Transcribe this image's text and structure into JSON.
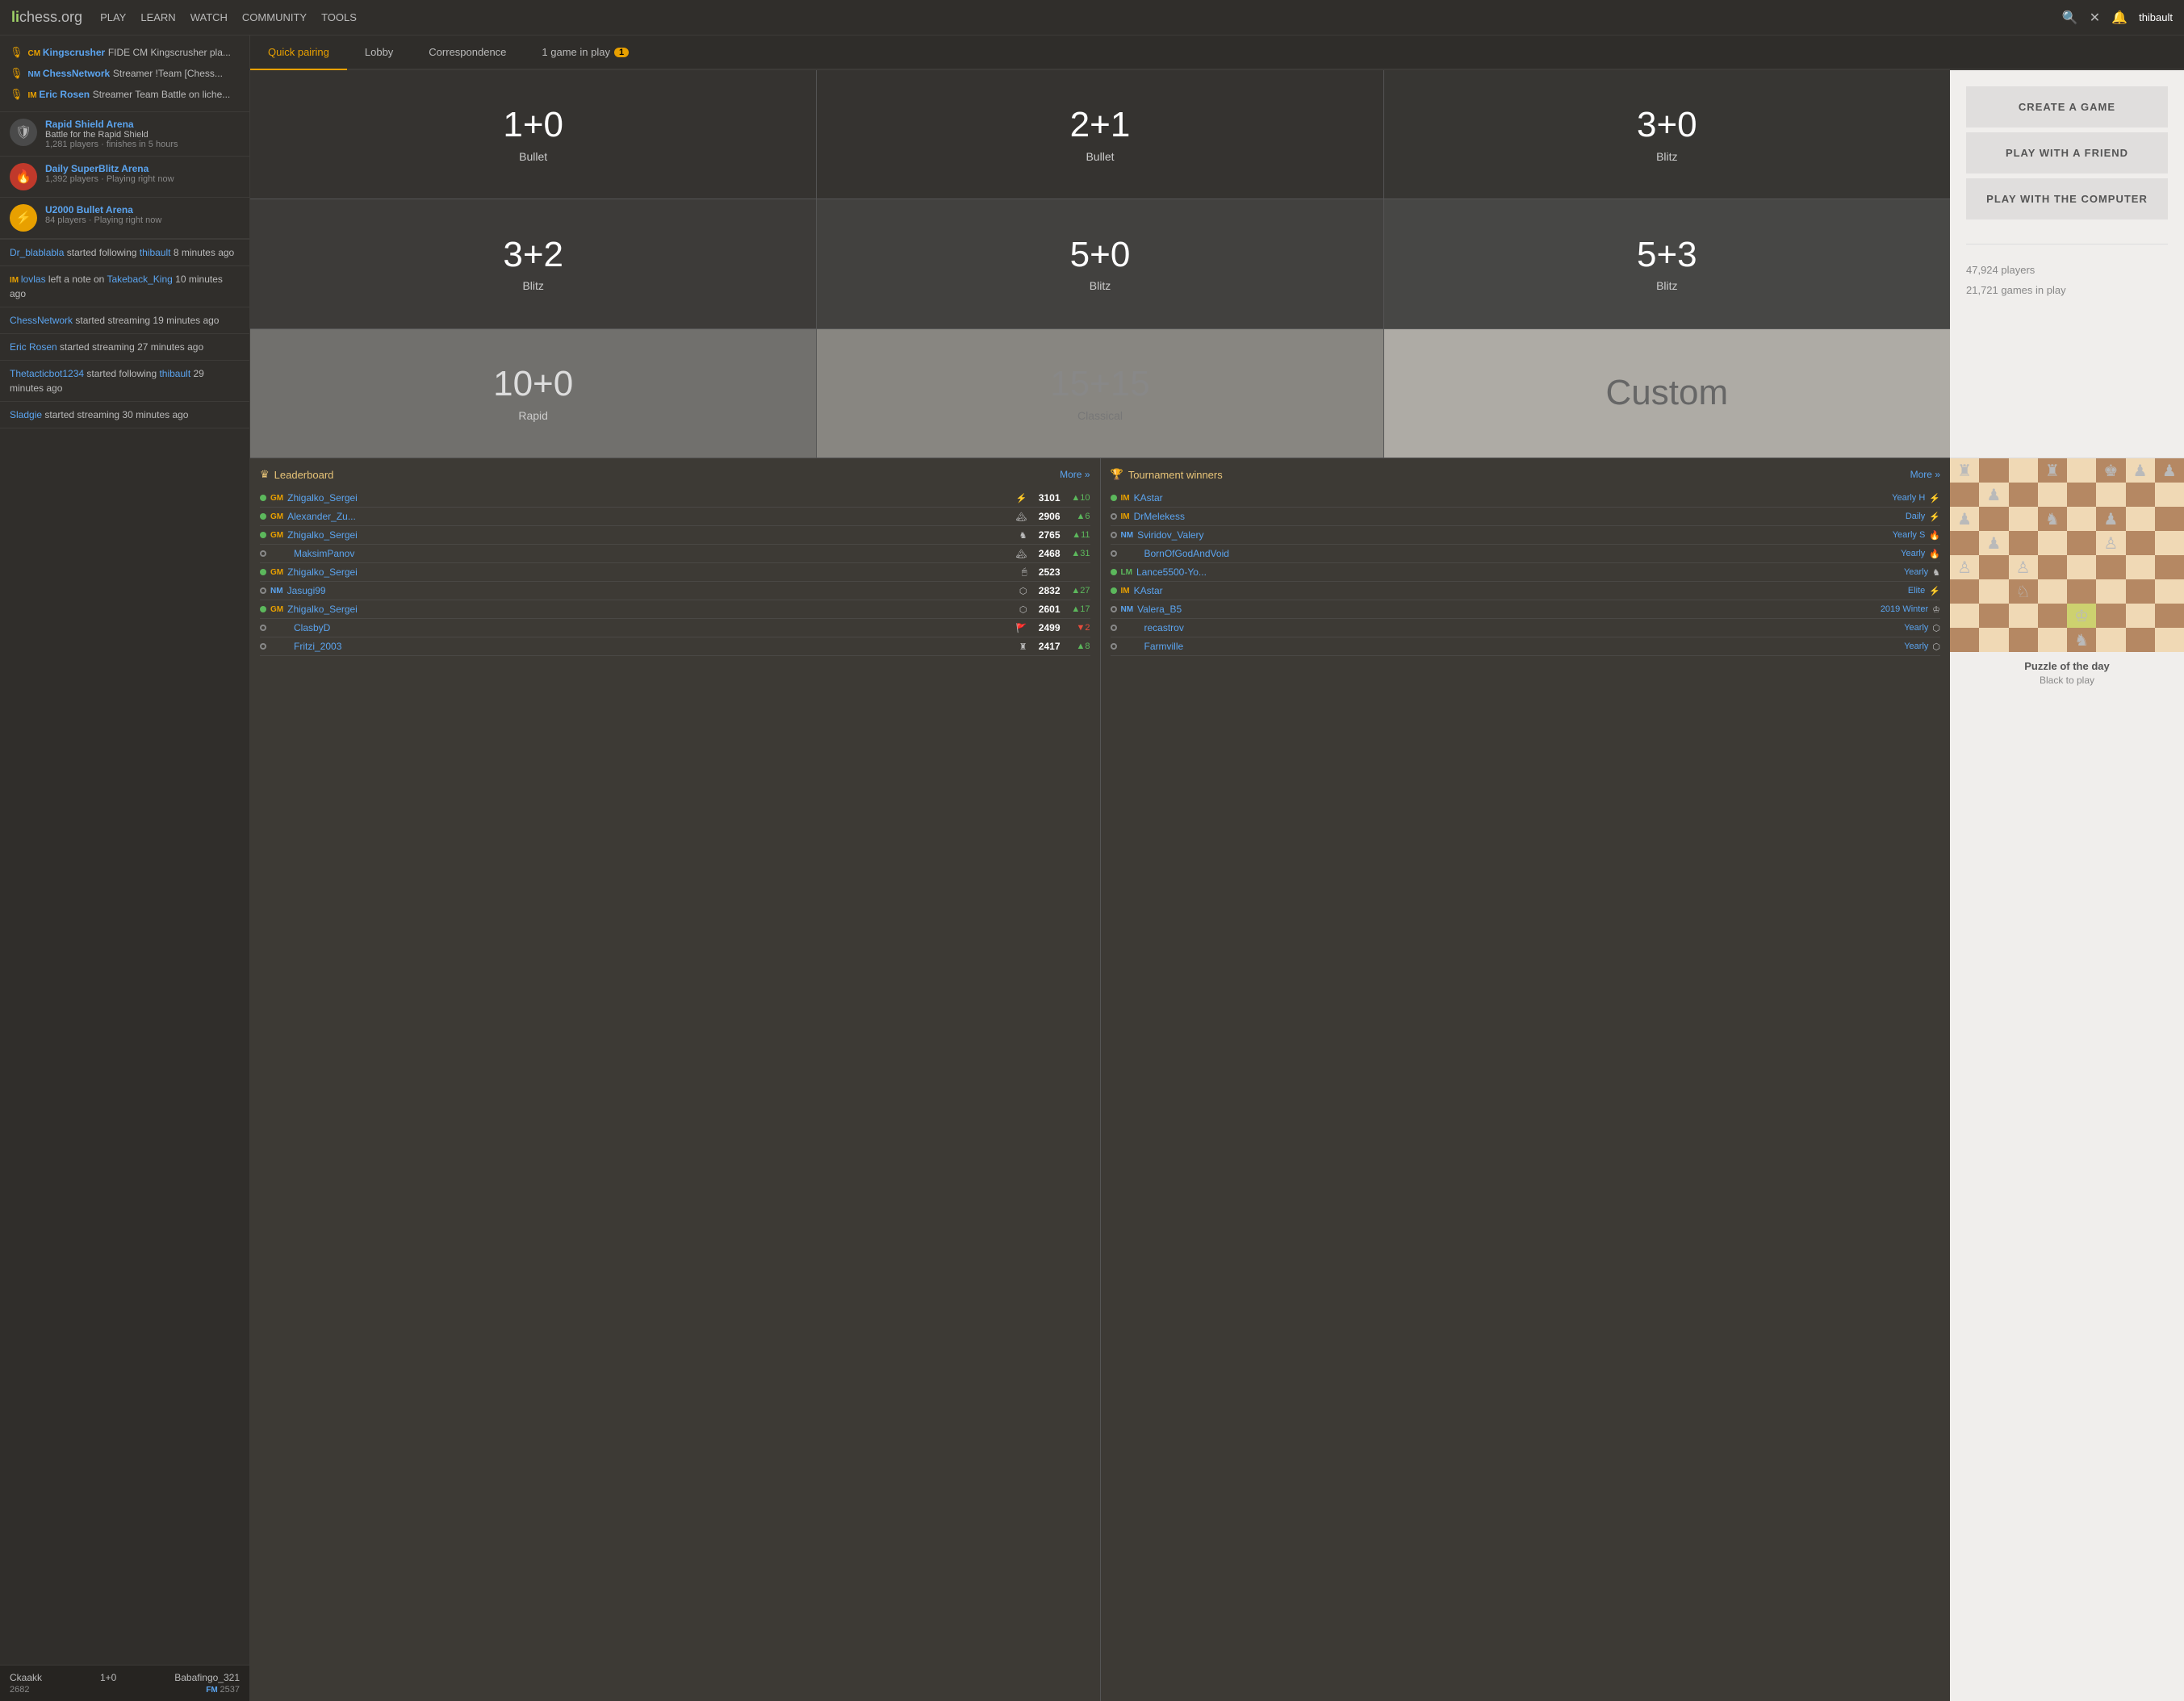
{
  "site": {
    "logo": "lichess",
    "logo_suffix": ".org"
  },
  "nav": {
    "links": [
      "PLAY",
      "LEARN",
      "WATCH",
      "COMMUNITY",
      "TOOLS"
    ],
    "username": "thibault",
    "game_in_play": "1 game in play",
    "game_badge": "1"
  },
  "tabs": [
    {
      "label": "Quick pairing",
      "active": true
    },
    {
      "label": "Lobby"
    },
    {
      "label": "Correspondence"
    },
    {
      "label": "1 game in play",
      "badge": "1"
    }
  ],
  "pairing_options": [
    {
      "time": "1+0",
      "type": "Bullet"
    },
    {
      "time": "2+1",
      "type": "Bullet"
    },
    {
      "time": "3+0",
      "type": "Blitz"
    },
    {
      "time": "3+2",
      "type": "Blitz"
    },
    {
      "time": "5+0",
      "type": "Blitz"
    },
    {
      "time": "5+3",
      "type": "Blitz"
    },
    {
      "time": "10+0",
      "type": "Rapid"
    },
    {
      "time": "15+15",
      "type": "Classical"
    },
    {
      "time": "Custom",
      "type": ""
    }
  ],
  "right_sidebar": {
    "create_game": "CREATE A GAME",
    "play_friend": "PLAY WITH A FRIEND",
    "play_computer": "PLAY WITH THE COMPUTER",
    "players_online": "47,924 players",
    "games_in_play": "21,721 games in play"
  },
  "streamers": [
    {
      "title": "CM",
      "name": "Kingscrusher",
      "desc": "FIDE CM Kingscrusher pla..."
    },
    {
      "title": "NM",
      "name": "ChessNetwork",
      "desc": "Streamer !Team [Chess..."
    },
    {
      "title": "IM",
      "name": "Eric Rosen",
      "desc": "Streamer Team Battle on liche..."
    }
  ],
  "tournaments": [
    {
      "type": "shield",
      "title": "Rapid Shield Arena",
      "subtitle": "Battle for the Rapid Shield",
      "meta": "1,281 players · finishes  in 5 hours"
    },
    {
      "type": "fire",
      "title": "Daily SuperBlitz Arena",
      "subtitle": "",
      "meta": "1,392 players · Playing right now"
    },
    {
      "type": "bolt",
      "title": "U2000 Bullet Arena",
      "subtitle": "",
      "meta": "84 players · Playing right now"
    }
  ],
  "activity": [
    {
      "text": "Dr_blablabla started following thibault 8 minutes ago",
      "links": [
        "Dr_blablabla",
        "thibault"
      ]
    },
    {
      "text": "IM lovlas left a note on Takeback_King 10 minutes ago",
      "links": [
        "lovlas",
        "Takeback_King"
      ]
    },
    {
      "text": "ChessNetwork started streaming 19 minutes ago",
      "links": [
        "ChessNetwork"
      ]
    },
    {
      "text": "Eric Rosen started streaming 27 minutes ago",
      "links": [
        "Eric Rosen"
      ]
    },
    {
      "text": "Thetacticbot1234 started following thibault 29 minutes ago",
      "links": [
        "Thetacticbot1234",
        "thibault"
      ]
    },
    {
      "text": "Sladgie started streaming 30 minutes ago",
      "links": [
        "Sladgie"
      ]
    }
  ],
  "leaderboard": {
    "title": "Leaderboard",
    "more": "More »",
    "rows": [
      {
        "online": true,
        "title": "GM",
        "name": "Zhigalko_Sergei",
        "icon": "⚡",
        "rating": "3101",
        "progress": "+10",
        "positive": true
      },
      {
        "online": true,
        "title": "GM",
        "name": "Alexander_Zu...",
        "icon": "🏔",
        "rating": "2906",
        "progress": "+6",
        "positive": true
      },
      {
        "online": true,
        "title": "GM",
        "name": "Zhigalko_Sergei",
        "icon": "♞",
        "rating": "2765",
        "progress": "+11",
        "positive": true
      },
      {
        "online": false,
        "title": "",
        "name": "MaksimPanov",
        "icon": "🏔",
        "rating": "2468",
        "progress": "+31",
        "positive": true
      },
      {
        "online": true,
        "title": "GM",
        "name": "Zhigalko_Sergei",
        "icon": "🖱",
        "rating": "2523",
        "progress": "",
        "positive": true
      },
      {
        "online": false,
        "title": "NM",
        "name": "Jasugi99",
        "icon": "⬡",
        "rating": "2832",
        "progress": "+27",
        "positive": true
      },
      {
        "online": true,
        "title": "GM",
        "name": "Zhigalko_Sergei",
        "icon": "⬡",
        "rating": "2601",
        "progress": "+17",
        "positive": true
      },
      {
        "online": false,
        "title": "",
        "name": "ClasbyD",
        "icon": "🚩",
        "rating": "2499",
        "progress": "-2",
        "positive": false
      },
      {
        "online": false,
        "title": "",
        "name": "Fritzi_2003",
        "icon": "♜",
        "rating": "2417",
        "progress": "+8",
        "positive": true
      }
    ]
  },
  "tournament_winners": {
    "title": "Tournament winners",
    "more": "More »",
    "rows": [
      {
        "online": true,
        "title": "IM",
        "name": "KAstar",
        "tournament": "Yearly H",
        "icon": "⚡"
      },
      {
        "online": false,
        "title": "IM",
        "name": "DrMelekess",
        "tournament": "Daily",
        "icon": "⚡"
      },
      {
        "online": false,
        "title": "NM",
        "name": "Sviridov_Valery",
        "tournament": "Yearly S",
        "icon": "🔥"
      },
      {
        "online": false,
        "title": "",
        "name": "BornOfGodAndVoid",
        "tournament": "Yearly",
        "icon": "🔥"
      },
      {
        "online": true,
        "title": "LM",
        "name": "Lance5500-Yo...",
        "tournament": "Yearly",
        "icon": "♞"
      },
      {
        "online": true,
        "title": "IM",
        "name": "KAstar",
        "tournament": "Elite",
        "icon": "⚡"
      },
      {
        "online": false,
        "title": "NM",
        "name": "Valera_B5",
        "tournament": "2019 Winter",
        "icon": "♔"
      },
      {
        "online": false,
        "title": "",
        "name": "recastrov",
        "tournament": "Yearly",
        "icon": "⬡"
      },
      {
        "online": false,
        "title": "",
        "name": "Farmville",
        "tournament": "Yearly",
        "icon": "⬡"
      }
    ]
  },
  "game_bottom": {
    "player1": "Ckaakk",
    "player1_rating": "2682",
    "time_control": "1+0",
    "player2": "Babafingo_321",
    "player2_rating": "2537",
    "player2_title": "FM"
  },
  "puzzle": {
    "title": "Puzzle of the day",
    "subtitle": "Black to play"
  }
}
